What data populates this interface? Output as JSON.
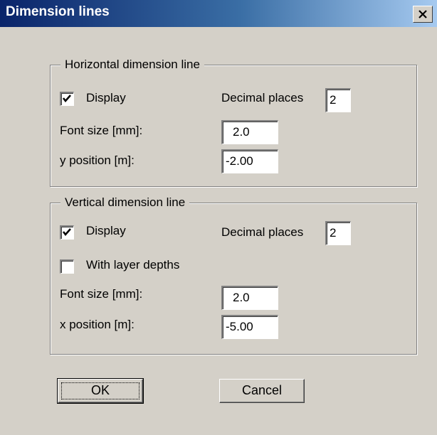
{
  "window": {
    "title": "Dimension lines",
    "close_symbol": "X"
  },
  "horizontal": {
    "legend": "Horizontal dimension line",
    "display_label": "Display",
    "display_checked": true,
    "decimal_label": "Decimal places",
    "decimal_value": "2",
    "font_size_label": "Font size [mm]:",
    "font_size_value": "2.0",
    "position_label": "y position [m]:",
    "position_value": "-2.00"
  },
  "vertical": {
    "legend": "Vertical dimension line",
    "display_label": "Display",
    "display_checked": true,
    "decimal_label": "Decimal places",
    "decimal_value": "2",
    "layer_depths_label": "With layer depths",
    "layer_depths_checked": false,
    "font_size_label": "Font size [mm]:",
    "font_size_value": "2.0",
    "position_label": "x position [m]:",
    "position_value": "-5.00"
  },
  "buttons": {
    "ok": "OK",
    "cancel": "Cancel"
  }
}
